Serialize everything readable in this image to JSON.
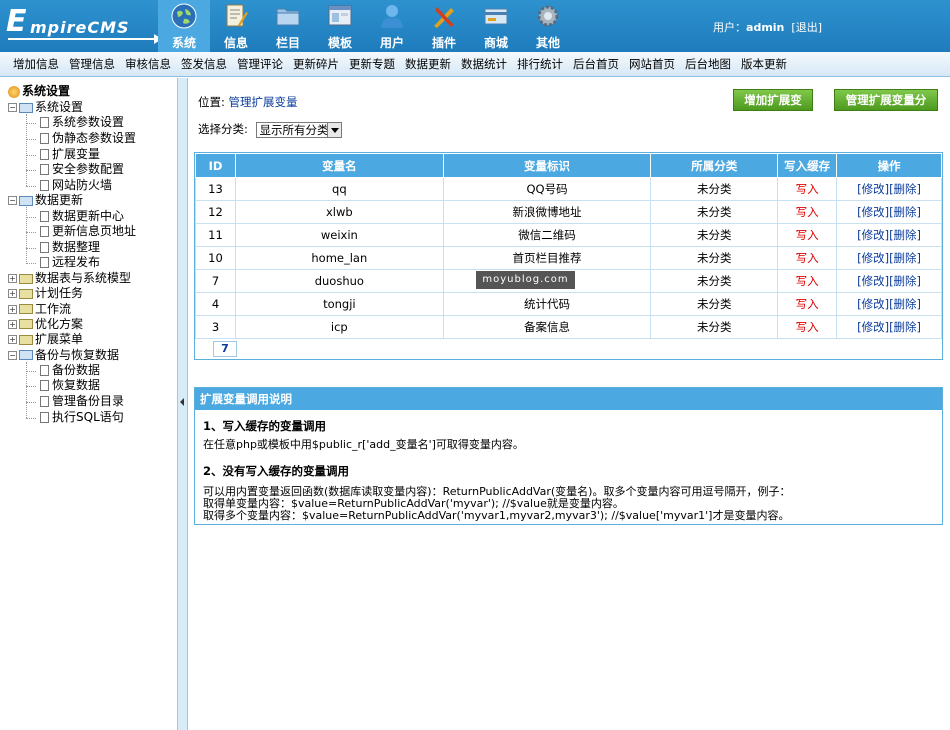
{
  "header": {
    "logo_first": "E",
    "logo_rest": "mpireCMS",
    "nav": [
      {
        "label": "系统",
        "icon": "globe-icon",
        "active": true
      },
      {
        "label": "信息",
        "icon": "document-pen-icon",
        "active": false
      },
      {
        "label": "栏目",
        "icon": "folder-icon",
        "active": false
      },
      {
        "label": "模板",
        "icon": "template-window-icon",
        "active": false
      },
      {
        "label": "用户",
        "icon": "user-icon",
        "active": false
      },
      {
        "label": "插件",
        "icon": "tools-icon",
        "active": false
      },
      {
        "label": "商城",
        "icon": "shop-card-icon",
        "active": false
      },
      {
        "label": "其他",
        "icon": "gear-icon",
        "active": false
      }
    ],
    "user_prefix": "用户：",
    "username": "admin",
    "logout": "[退出]"
  },
  "subnav": [
    "增加信息",
    "管理信息",
    "审核信息",
    "签发信息",
    "管理评论",
    "更新碎片",
    "更新专题",
    "数据更新",
    "数据统计",
    "排行统计",
    "后台首页",
    "网站首页",
    "后台地图",
    "版本更新"
  ],
  "sidebar": {
    "root": "系统设置",
    "groups": [
      {
        "label": "系统设置",
        "expanded": true,
        "children": [
          "系统参数设置",
          "伪静态参数设置",
          "扩展变量",
          "安全参数配置",
          "网站防火墙"
        ]
      },
      {
        "label": "数据更新",
        "expanded": true,
        "children": [
          "数据更新中心",
          "更新信息页地址",
          "数据整理",
          "远程发布"
        ]
      },
      {
        "label": "数据表与系统模型",
        "expanded": false,
        "children": []
      },
      {
        "label": "计划任务",
        "expanded": false,
        "children": []
      },
      {
        "label": "工作流",
        "expanded": false,
        "children": []
      },
      {
        "label": "优化方案",
        "expanded": false,
        "children": []
      },
      {
        "label": "扩展菜单",
        "expanded": false,
        "children": []
      },
      {
        "label": "备份与恢复数据",
        "expanded": true,
        "children": [
          "备份数据",
          "恢复数据",
          "管理备份目录",
          "执行SQL语句"
        ]
      }
    ]
  },
  "main": {
    "position_label": "位置:",
    "position_link": "管理扩展变量",
    "add_button": "增加扩展变量",
    "manage_class_button": "管理扩展变量分类",
    "filter_label": "选择分类:",
    "filter_value": "显示所有分类",
    "table": {
      "headers": [
        "ID",
        "变量名",
        "变量标识",
        "所属分类",
        "写入缓存",
        "操作"
      ],
      "rows": [
        {
          "id": "13",
          "name": "qq",
          "title": "QQ号码",
          "class": "未分类",
          "cache": "写入",
          "edit": "[修改]",
          "del": "[删除]"
        },
        {
          "id": "12",
          "name": "xlwb",
          "title": "新浪微博地址",
          "class": "未分类",
          "cache": "写入",
          "edit": "[修改]",
          "del": "[删除]"
        },
        {
          "id": "11",
          "name": "weixin",
          "title": "微信二维码",
          "class": "未分类",
          "cache": "写入",
          "edit": "[修改]",
          "del": "[删除]"
        },
        {
          "id": "10",
          "name": "home_lan",
          "title": "首页栏目推荐",
          "class": "未分类",
          "cache": "写入",
          "edit": "[修改]",
          "del": "[删除]"
        },
        {
          "id": "7",
          "name": "duoshuo",
          "title": "",
          "class": "未分类",
          "cache": "写入",
          "edit": "[修改]",
          "del": "[删除]"
        },
        {
          "id": "4",
          "name": "tongji",
          "title": "统计代码",
          "class": "未分类",
          "cache": "写入",
          "edit": "[修改]",
          "del": "[删除]"
        },
        {
          "id": "3",
          "name": "icp",
          "title": "备案信息",
          "class": "未分类",
          "cache": "写入",
          "edit": "[修改]",
          "del": "[删除]"
        }
      ]
    },
    "pager": "7",
    "watermark": "moyublog.com",
    "help": {
      "title": "扩展变量调用说明",
      "h1": "1、写入缓存的变量调用",
      "t1": "在任意php或模板中用$public_r['add_变量名']可取得变量内容。",
      "h2": "2、没有写入缓存的变量调用",
      "t2a": "可以用内置变量返回函数(数据库读取变量内容)：ReturnPublicAddVar(变量名)。取多个变量内容可用逗号隔开，例子：",
      "t2b": "取得单变量内容：$value=ReturnPublicAddVar('myvar'); //$value就是变量内容。",
      "t2c": "取得多个变量内容：$value=ReturnPublicAddVar('myvar1,myvar2,myvar3'); //$value['myvar1']才是变量内容。"
    }
  }
}
